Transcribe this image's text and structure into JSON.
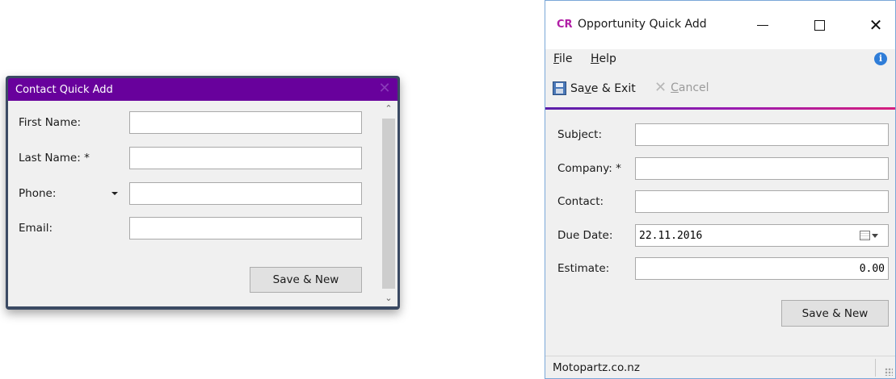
{
  "contact_window": {
    "title": "Contact Quick Add",
    "close_glyph": "✕",
    "fields": {
      "first_name": {
        "label": "First Name:",
        "value": ""
      },
      "last_name": {
        "label": "Last Name: *",
        "value": ""
      },
      "phone": {
        "label": "Phone:",
        "value": ""
      },
      "email": {
        "label": "Email:",
        "value": ""
      }
    },
    "save_new_label": "Save & New",
    "scroll_up_glyph": "⌃",
    "scroll_down_glyph": "⌄"
  },
  "opportunity_window": {
    "app_logo": "CR",
    "title": "Opportunity Quick Add",
    "menu": {
      "file": {
        "accel": "F",
        "rest": "ile"
      },
      "help": {
        "accel": "H",
        "rest": "elp"
      }
    },
    "toolbar": {
      "save_exit": {
        "pre": "Sa",
        "accel": "v",
        "post": "e & Exit"
      },
      "cancel": {
        "accel": "C",
        "rest": "ancel"
      }
    },
    "fields": {
      "subject": {
        "label": "Subject:",
        "value": ""
      },
      "company": {
        "label": "Company: *",
        "value": ""
      },
      "contact": {
        "label": "Contact:",
        "value": ""
      },
      "due_date": {
        "label": "Due Date:",
        "value": "22.11.2016"
      },
      "estimate": {
        "label": "Estimate:",
        "value": "0.00"
      }
    },
    "save_new_label": "Save & New",
    "status_text": "Motopartz.co.nz",
    "colors": {
      "accent_start": "#5a1faa",
      "accent_end": "#d61f7d",
      "logo": "#b11ea6"
    },
    "icons": [
      "save-icon",
      "cancel-icon",
      "info-icon",
      "calendar-icon"
    ]
  }
}
